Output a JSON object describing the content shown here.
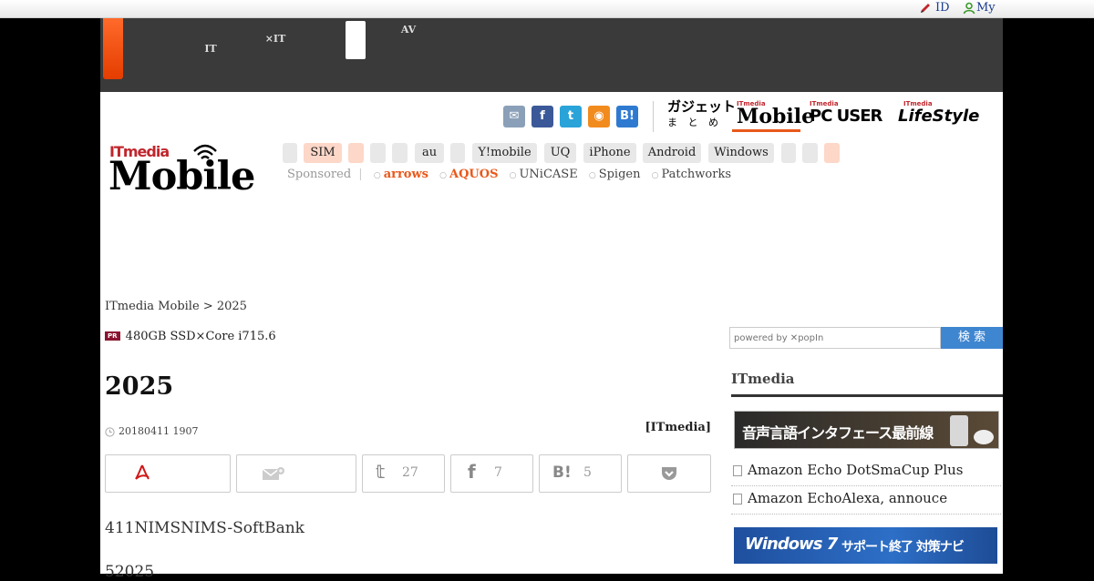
{
  "topbar": {
    "id_label": "ID",
    "my_label": "My"
  },
  "darknav": {
    "item1": [
      "",
      "IT"
    ],
    "item2": [
      "",
      "×IT"
    ],
    "item3": [
      "AV",
      ""
    ]
  },
  "brands": {
    "gadget_line1": "ガジェット",
    "gadget_line2": "ま と め",
    "mobile_small": "ITmedia",
    "mobile": "Mobile",
    "pcuser_small": "ITmedia",
    "pcuser": "PC USER",
    "lifestyle_small": "ITmedia",
    "lifestyle": "LifeStyle"
  },
  "logo": {
    "small": "ITmedia",
    "big": "Mobile"
  },
  "nav_pills": [
    "",
    "SIM",
    "",
    "",
    "",
    "au",
    "",
    "Y!mobile",
    "UQ",
    "iPhone",
    "Android",
    "Windows",
    "",
    "",
    ""
  ],
  "sponsored": {
    "label": "Sponsored",
    "items": [
      "arrows",
      "AQUOS",
      "UNiCASE",
      "Spigen",
      "Patchworks"
    ]
  },
  "breadcrumb": {
    "root": "ITmedia Mobile",
    "sep": ">",
    "current": "2025"
  },
  "pr": {
    "badge": "PR",
    "text": "480GB SSD×Core i715.6"
  },
  "article": {
    "title": "2025",
    "date": "20180411 1907",
    "source": "[ITmedia]",
    "lead": "411NIMSNIMS-SoftBank",
    "para2": "52025"
  },
  "actions": {
    "twitter_count": "27",
    "facebook_count": "7",
    "hatena_count": "5"
  },
  "search": {
    "placeholder": "powered by ✕popIn",
    "button": "検 索"
  },
  "sidebar": {
    "heading": "ITmedia",
    "banner1": "音声言語インタフェース最前線",
    "links": [
      "Amazon Echo DotSmaCup Plus",
      "Amazon EchoAlexa, annouce"
    ],
    "banner2_main": "Windows 7",
    "banner2_sub": "サポート終了 対策ナビ"
  },
  "colors": {
    "accent": "#e9581b",
    "link": "#1a3c8e",
    "dark_header": "#3a3a3a"
  }
}
